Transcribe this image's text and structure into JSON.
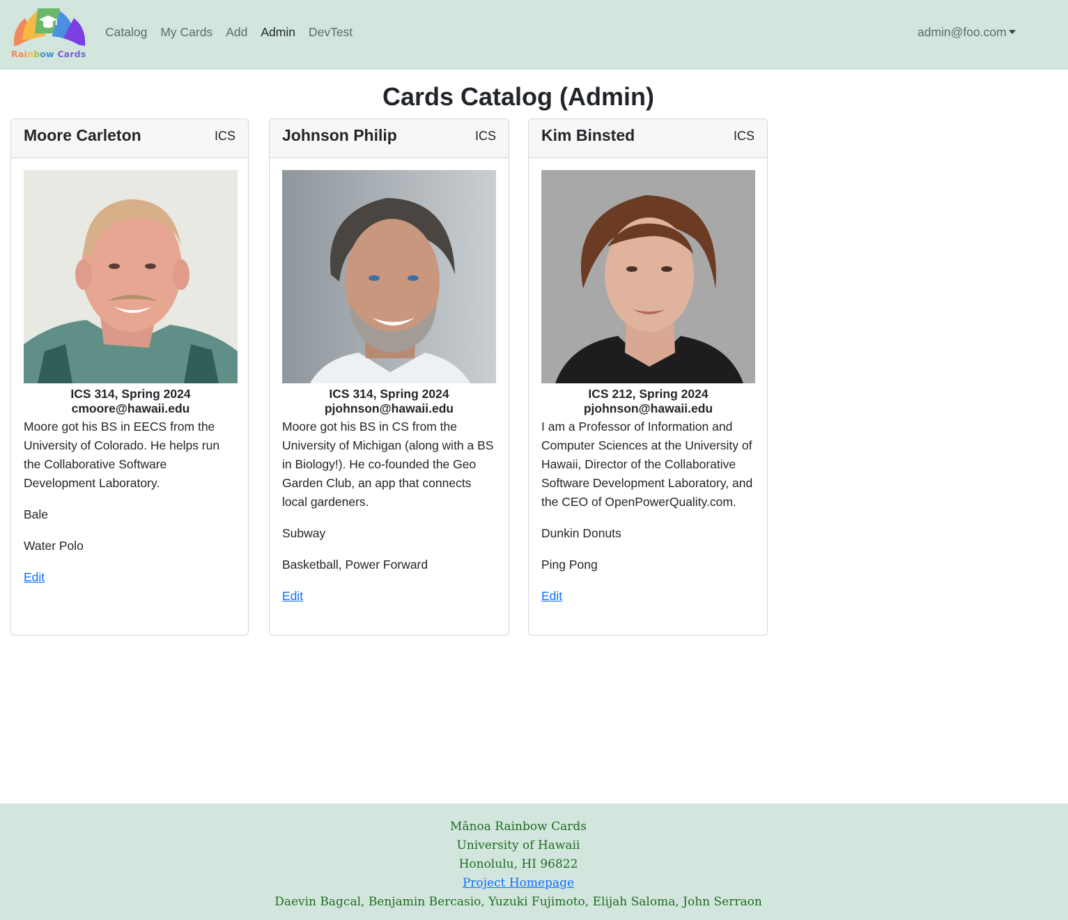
{
  "navbar": {
    "logo_text_parts": [
      {
        "text": "Rai",
        "color": "#f08a5d"
      },
      {
        "text": "n",
        "color": "#f4b942"
      },
      {
        "text": "b",
        "color": "#9bc53d"
      },
      {
        "text": "ow ",
        "color": "#3f8fd2"
      },
      {
        "text": "Cards",
        "color": "#7b61c9"
      }
    ],
    "links": [
      {
        "label": "Catalog",
        "active": false
      },
      {
        "label": "My Cards",
        "active": false
      },
      {
        "label": "Add",
        "active": false
      },
      {
        "label": "Admin",
        "active": true
      },
      {
        "label": "DevTest",
        "active": false
      }
    ],
    "user": "admin@foo.com",
    "bg_color": "#d2e6de"
  },
  "page": {
    "title": "Cards Catalog (Admin)"
  },
  "cards": [
    {
      "name": "Moore Carleton",
      "dept": "ICS",
      "course": "ICS 314, Spring 2024",
      "email": "cmoore@hawaii.edu",
      "description": "Moore got his BS in EECS from the University of Colorado. He helps run the Collaborative Software Development Laboratory.",
      "favorite_food": "Bale",
      "sport": "Water Polo",
      "edit_label": "Edit"
    },
    {
      "name": "Johnson Philip",
      "dept": "ICS",
      "course": "ICS 314, Spring 2024",
      "email": "pjohnson@hawaii.edu",
      "description": "Moore got his BS in CS from the University of Michigan (along with a BS in Biology!). He co-founded the Geo Garden Club, an app that connects local gardeners.",
      "favorite_food": "Subway",
      "sport": "Basketball, Power Forward",
      "edit_label": "Edit"
    },
    {
      "name": "Kim Binsted",
      "dept": "ICS",
      "course": "ICS 212, Spring 2024",
      "email": "pjohnson@hawaii.edu",
      "description": "I am a Professor of Information and Computer Sciences at the University of Hawaii, Director of the Collaborative Software Development Laboratory, and the CEO of OpenPowerQuality.com.",
      "favorite_food": "Dunkin Donuts",
      "sport": "Ping Pong",
      "edit_label": "Edit"
    }
  ],
  "footer": {
    "line1": "Mānoa Rainbow Cards",
    "line2": "University of Hawaii",
    "line3": "Honolulu, HI 96822",
    "link_label": "Project Homepage",
    "credits": "Daevin Bagcal, Benjamin Bercasio, Yuzuki Fujimoto, Elijah Saloma, John Serraon",
    "text_color": "#1e6b1e"
  }
}
